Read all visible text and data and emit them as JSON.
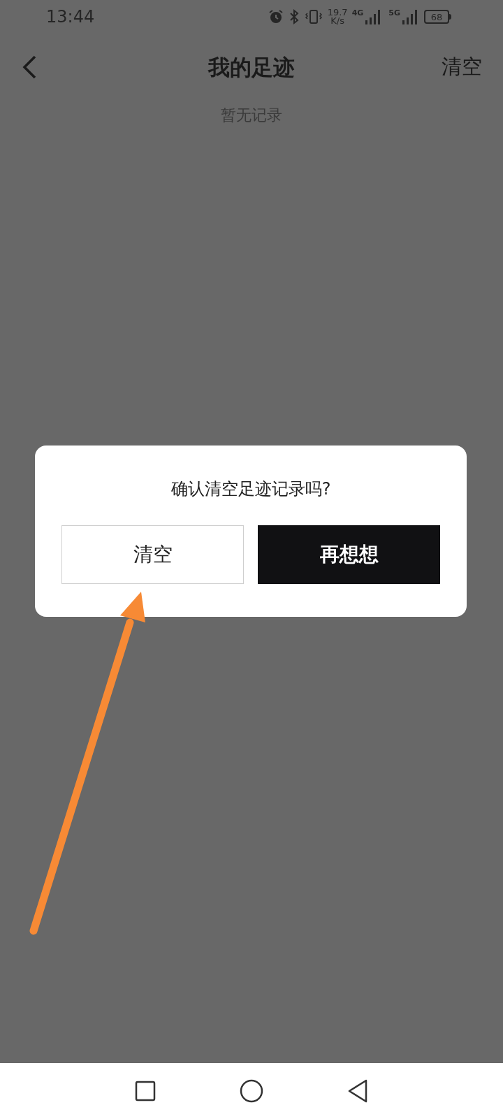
{
  "status_bar": {
    "time": "13:44",
    "speed_value": "19.7",
    "speed_unit": "K/s",
    "networks": [
      "4G",
      "5G"
    ],
    "battery": "68"
  },
  "header": {
    "title": "我的足迹",
    "action": "清空"
  },
  "empty_message": "暂无记录",
  "dialog": {
    "message": "确认清空足迹记录吗?",
    "buttons": [
      {
        "label": "清空",
        "kind": "outline"
      },
      {
        "label": "再想想",
        "kind": "filled"
      }
    ]
  },
  "annotation": {
    "kind": "arrow"
  }
}
